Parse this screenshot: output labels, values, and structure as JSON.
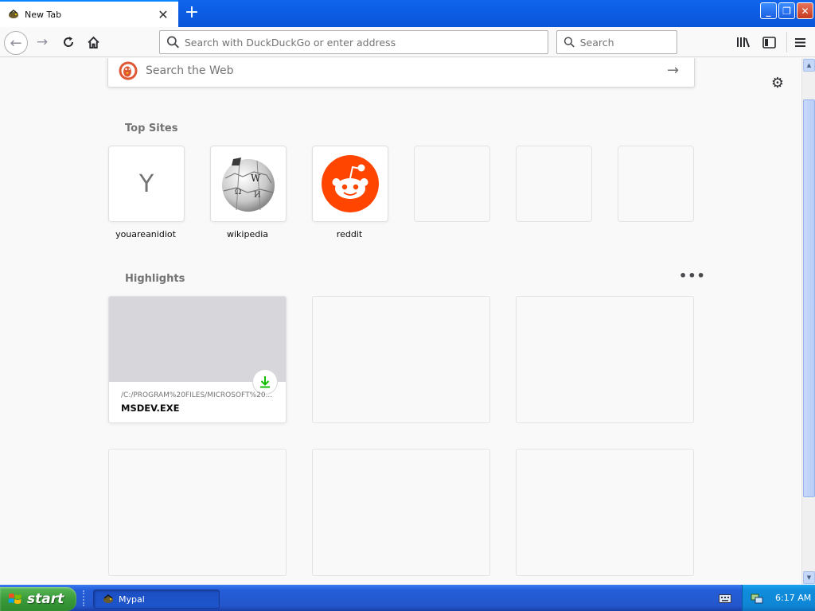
{
  "tab": {
    "title": "New Tab"
  },
  "toolbar": {
    "url_placeholder": "Search with DuckDuckGo or enter address",
    "search_placeholder": "Search"
  },
  "content": {
    "web_search_placeholder": "Search the Web",
    "top_sites_heading": "Top Sites",
    "top_sites": [
      {
        "label": "youareanidiot",
        "letter": "Y"
      },
      {
        "label": "wikipedia"
      },
      {
        "label": "reddit"
      },
      {
        "label": ""
      },
      {
        "label": ""
      },
      {
        "label": ""
      }
    ],
    "highlights_heading": "Highlights",
    "highlights": [
      {
        "url": "/C:/PROGRAM%20FILES/MICROSOFT%20...",
        "name": "MSDEV.EXE",
        "type": "download"
      }
    ]
  },
  "taskbar": {
    "start_label": "start",
    "task_label": "Mypal",
    "clock": "6:17 AM"
  },
  "colors": {
    "reddit_orange": "#ff4500",
    "download_green": "#12bc00",
    "ddg_orange": "#de5833",
    "xp_blue": "#245ed8",
    "xp_green": "#3a9a3a"
  }
}
